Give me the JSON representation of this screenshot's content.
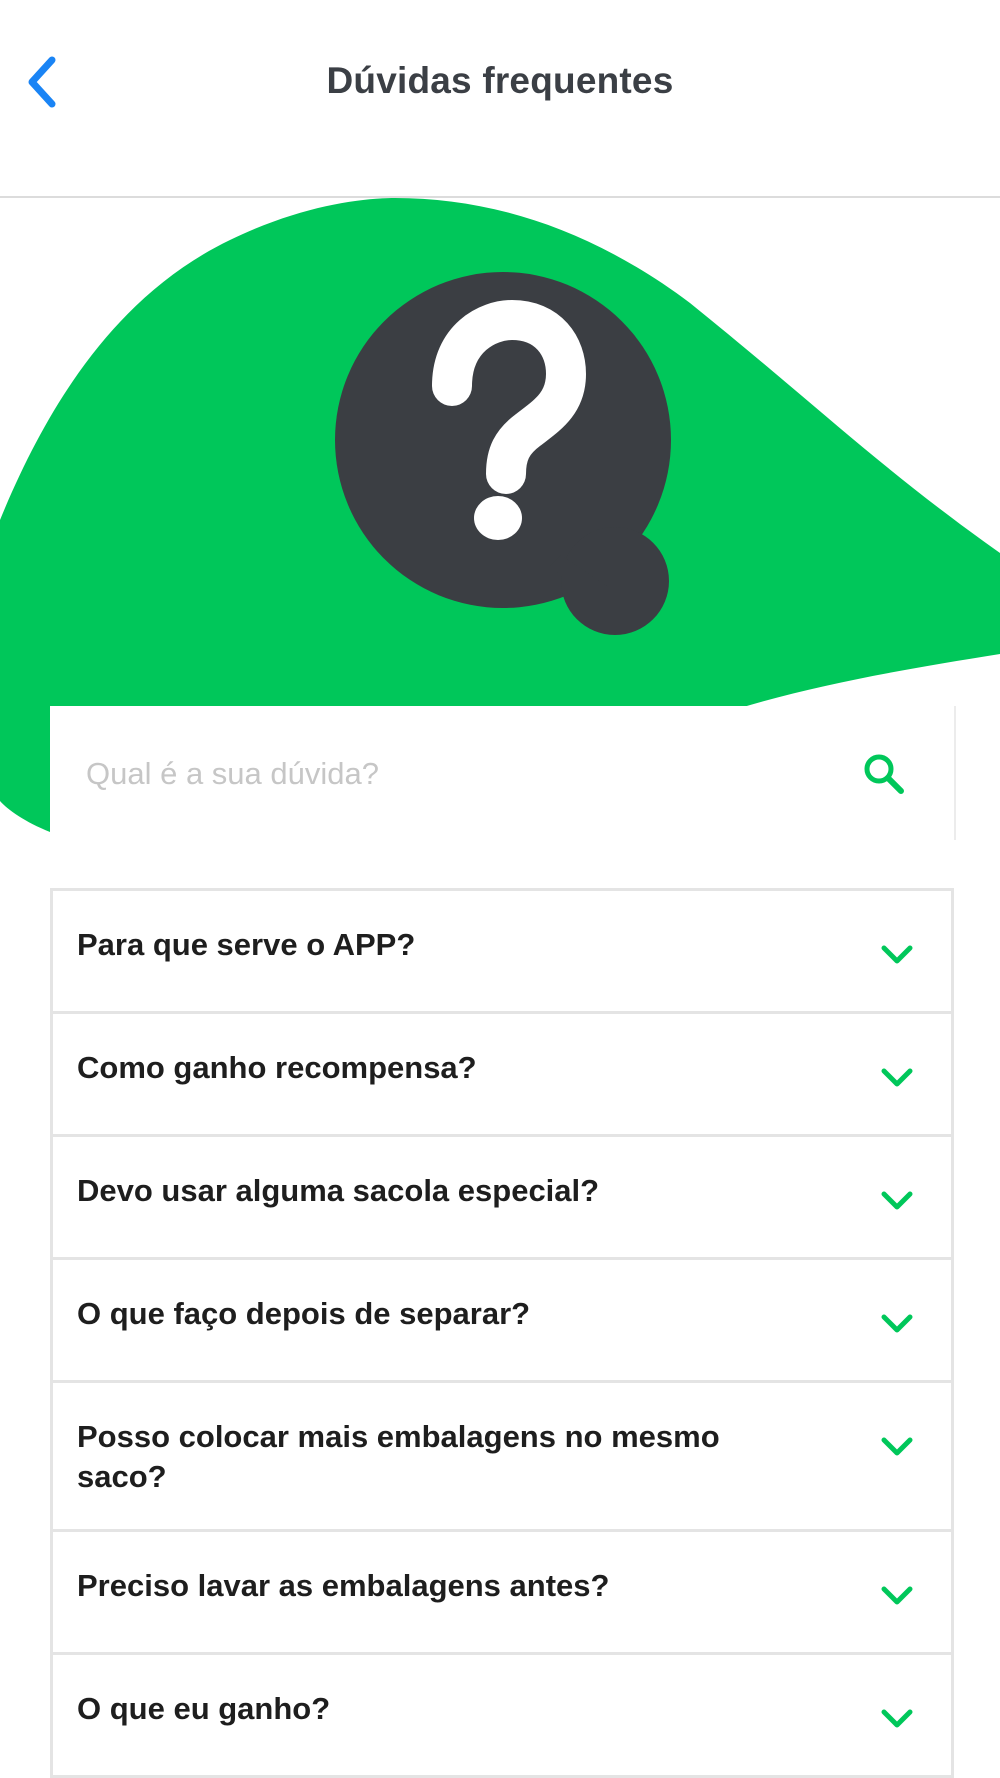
{
  "header": {
    "title": "Dúvidas frequentes",
    "back_icon": "chevron-left-icon"
  },
  "hero": {
    "icon": "question-bubble-icon",
    "question_mark": "?"
  },
  "search": {
    "placeholder": "Qual é a sua dúvida?",
    "value": "",
    "icon": "search-icon"
  },
  "faq": {
    "chevron_icon": "chevron-down-icon",
    "items": [
      {
        "question": "Para que serve o APP?"
      },
      {
        "question": "Como ganho recompensa?"
      },
      {
        "question": "Devo usar alguma sacola especial?"
      },
      {
        "question": "O que faço depois de separar?"
      },
      {
        "question": "Posso colocar mais embalagens no mesmo saco?"
      },
      {
        "question": "Preciso lavar as embalagens antes?"
      },
      {
        "question": "O que eu ganho?"
      }
    ]
  },
  "colors": {
    "accent_green": "#00c75a",
    "dark_icon": "#3b3e43",
    "link_blue": "#1a84f5",
    "title_text": "#3b3f45",
    "question_text": "#1e1e1e",
    "placeholder_text": "#c6c6c6",
    "border": "#e4e4e4"
  }
}
